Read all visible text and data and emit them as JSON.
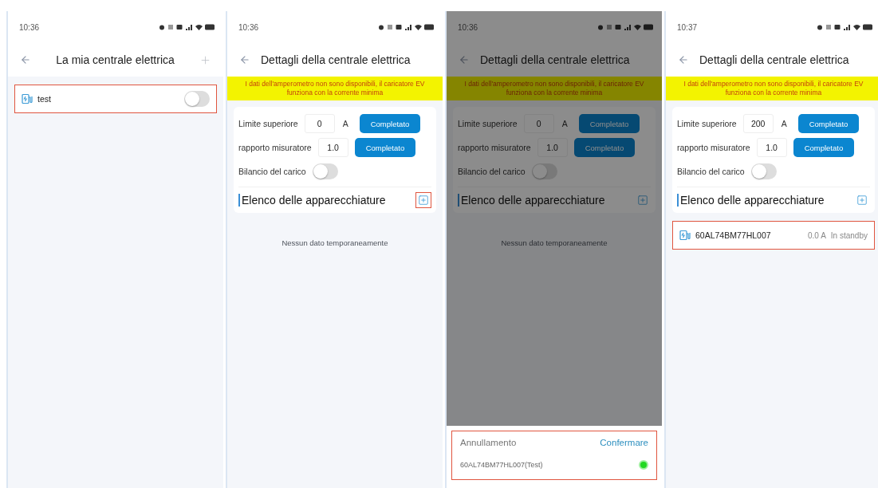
{
  "screens": [
    {
      "kind": "list",
      "time": "10:36",
      "title": "La mia centrale elettrica",
      "dimmed": false,
      "add_highlighted": false,
      "items": [
        {
          "name": "test",
          "on": false,
          "highlighted": true
        }
      ]
    },
    {
      "kind": "details",
      "time": "10:36",
      "title": "Dettagli della centrale elettrica",
      "dimmed": false,
      "warning": "I dati dell'amperometro non sono disponibili, il caricatore EV funziona con la corrente minima",
      "settings": [
        {
          "kind": "input",
          "label": "Limite superiore",
          "value": "0",
          "unit": "A",
          "button": "Completato"
        },
        {
          "kind": "input",
          "label": "rapporto misuratore",
          "value": "1.0",
          "button": "Completato"
        },
        {
          "kind": "switch",
          "label": "Bilancio del carico",
          "on": false
        }
      ],
      "section": "Elenco delle apparecchiature",
      "add_highlighted": true,
      "empty": "Nessun dato temporaneamente"
    },
    {
      "kind": "details",
      "time": "10:36",
      "title": "Dettagli della centrale elettrica",
      "dimmed": true,
      "warning": "I dati dell'amperometro non sono disponibili, il caricatore EV funziona con la corrente minima",
      "settings": [
        {
          "kind": "input",
          "label": "Limite superiore",
          "value": "0",
          "unit": "A",
          "button": "Completato"
        },
        {
          "kind": "input",
          "label": "rapporto misuratore",
          "value": "1.0",
          "button": "Completato"
        },
        {
          "kind": "switch",
          "label": "Bilancio del carico",
          "on": false
        }
      ],
      "section": "Elenco delle apparecchiature",
      "add_highlighted": false,
      "empty": "Nessun dato temporaneamente",
      "sheet": {
        "cancel": "Annullamento",
        "confirm": "Confermare",
        "highlighted": true,
        "options": [
          {
            "label": "60AL74BM77HL007(Test)",
            "selected": true
          }
        ]
      }
    },
    {
      "kind": "details",
      "time": "10:37",
      "title": "Dettagli della centrale elettrica",
      "dimmed": false,
      "warning": "I dati dell'amperometro non sono disponibili, il caricatore EV funziona con la corrente minima",
      "settings": [
        {
          "kind": "input",
          "label": "Limite superiore",
          "value": "200",
          "unit": "A",
          "button": "Completato"
        },
        {
          "kind": "input",
          "label": "rapporto misuratore",
          "value": "1.0",
          "button": "Completato"
        },
        {
          "kind": "switch",
          "label": "Bilancio del carico",
          "on": false
        }
      ],
      "section": "Elenco delle apparecchiature",
      "add_highlighted": false,
      "devices": [
        {
          "name": "60AL74BM77HL007",
          "reading": "0.0 A",
          "status": "In standby",
          "highlighted": true
        }
      ]
    }
  ]
}
